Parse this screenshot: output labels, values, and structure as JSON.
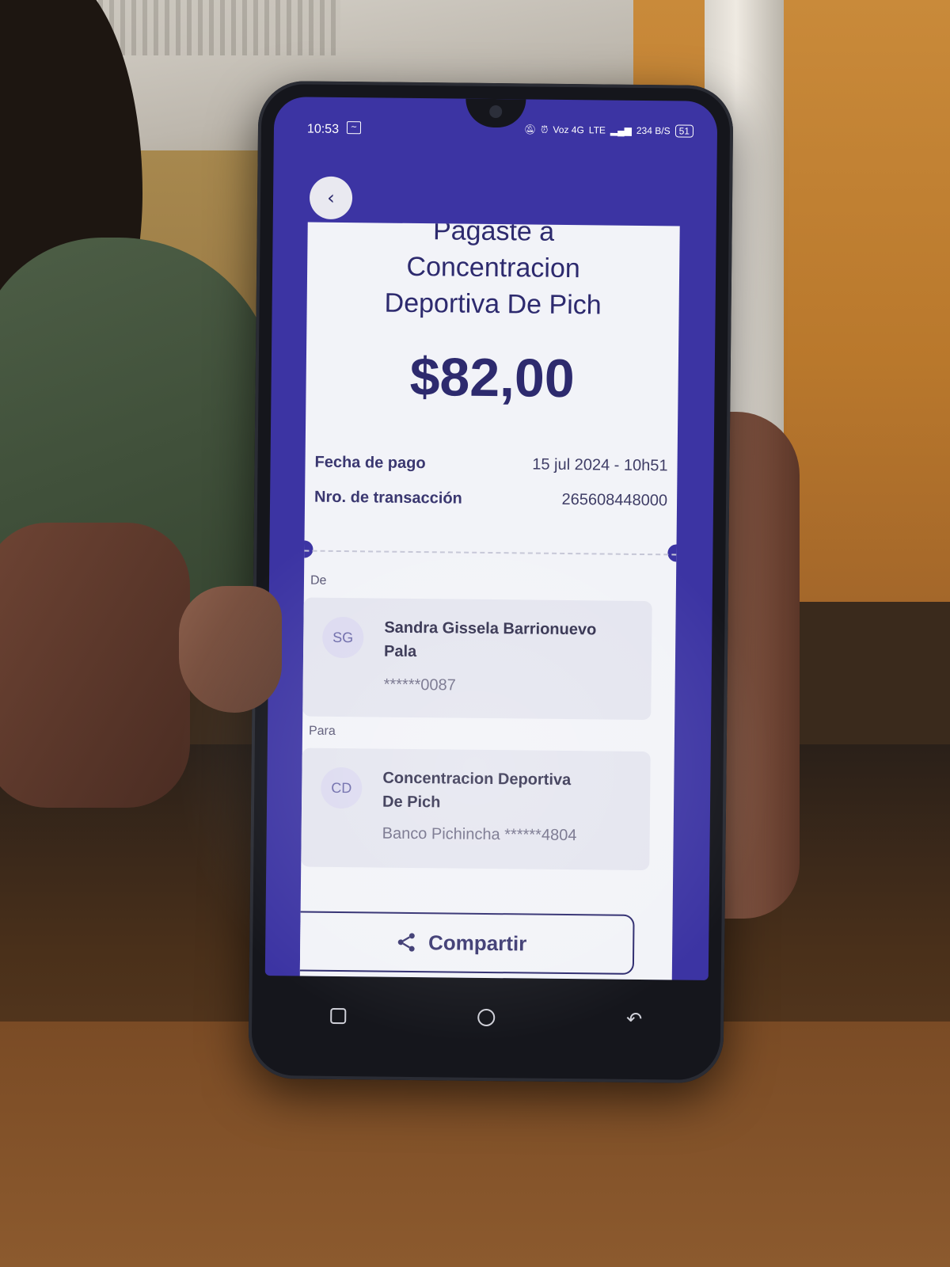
{
  "status_bar": {
    "time": "10:53",
    "network": "Voz 4G",
    "lte": "LTE",
    "speed": "234 B/S",
    "battery": "51"
  },
  "receipt": {
    "heading_line1": "Pagaste a",
    "heading_line2": "Concentracion",
    "heading_line3": "Deportiva De Pich",
    "amount": "$82,00",
    "payment_date_label": "Fecha de pago",
    "payment_date_value": "15 jul 2024 - 10h51",
    "transaction_label": "Nro. de transacción",
    "transaction_value": "265608448000"
  },
  "from": {
    "section_label": "De",
    "initials": "SG",
    "name_line1": "Sandra Gissela Barrionuevo",
    "name_line2": "Pala",
    "account": "******0087"
  },
  "to": {
    "section_label": "Para",
    "initials": "CD",
    "name_line1": "Concentracion Deportiva",
    "name_line2": "De Pich",
    "account": "Banco Pichincha ******4804"
  },
  "actions": {
    "share_label": "Compartir"
  },
  "colors": {
    "header_bg": "#3c34a3",
    "accent_text": "#2d2a6e",
    "card_bg": "#f2f3f8"
  }
}
